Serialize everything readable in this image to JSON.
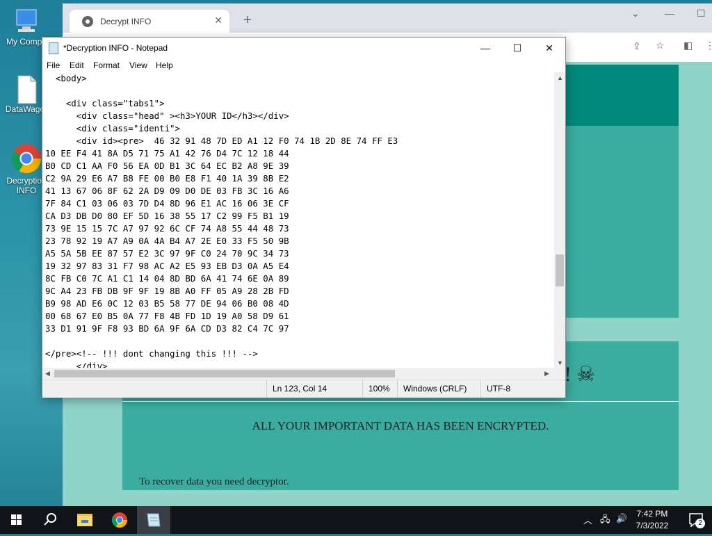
{
  "desktop": {
    "icons": [
      {
        "label": "My Compu"
      },
      {
        "label": "DataWagor"
      },
      {
        "label": "Decryption INFO"
      }
    ]
  },
  "chrome": {
    "tab_title": "Decrypt INFO",
    "page": {
      "banner_end": "D! ☠",
      "encrypted_text": "ALL YOUR IMPORTANT DATA HAS BEEN ENCRYPTED.",
      "recover_text": "To recover data you need decryptor."
    }
  },
  "notepad": {
    "title": "*Decryption INFO - Notepad",
    "menu": [
      "File",
      "Edit",
      "Format",
      "View",
      "Help"
    ],
    "content": "  <body>\n\n    <div class=\"tabs1\">\n      <div class=\"head\" ><h3>YOUR ID</h3></div>\n      <div class=\"identi\">\n      <div id><pre>  46 32 91 48 7D ED A1 12 F0 74 1B 2D 8E 74 FF E3\n10 EE F4 41 8A D5 71 75 A1 42 76 D4 7C 12 18 44\nB0 CD C1 AA F0 56 EA 0D B1 3C 64 EC B2 A8 9E 39\nC2 9A 29 E6 A7 B8 FE 00 B0 E8 F1 40 1A 39 8B E2\n41 13 67 06 8F 62 2A D9 09 D0 DE 03 FB 3C 16 A6\n7F 84 C1 03 06 03 7D D4 8D 96 E1 AC 16 06 3E CF\nCA D3 DB D0 80 EF 5D 16 38 55 17 C2 99 F5 B1 19\n73 9E 15 15 7C A7 97 92 6C CF 74 A8 55 44 48 73\n23 78 92 19 A7 A9 0A 4A B4 A7 2E E0 33 F5 50 9B\nA5 5A 5B EE 87 57 E2 3C 97 9F C0 24 70 9C 34 73\n19 32 97 83 31 F7 98 AC A2 E5 93 EB D3 0A A5 E4\n8C FB C0 7C A1 C1 14 04 8D BD 6A 41 74 6E 0A 89\n9C A4 23 FB DB 9F 9F 19 8B A0 FF 05 A9 28 2B FD\nB9 98 AD E6 0C 12 03 B5 58 77 DE 94 06 B0 08 4D\n00 68 67 E0 B5 0A 77 F8 4B FD 1D 19 A0 58 D9 61\n33 D1 91 9F F8 93 BD 6A 9F 6A CD D3 82 C4 7C 97\n\n</pre><!-- !!! dont changing this !!! -->\n      </div>",
    "status": {
      "position": "Ln 123, Col 14",
      "zoom": "100%",
      "line_ending": "Windows (CRLF)",
      "encoding": "UTF-8"
    }
  },
  "taskbar": {
    "apps": [
      "start-icon",
      "search-icon",
      "file-explorer-icon",
      "chrome-icon",
      "notepad-icon"
    ],
    "clock_time": "7:42 PM",
    "clock_date": "7/3/2022",
    "notification_count": "2"
  }
}
